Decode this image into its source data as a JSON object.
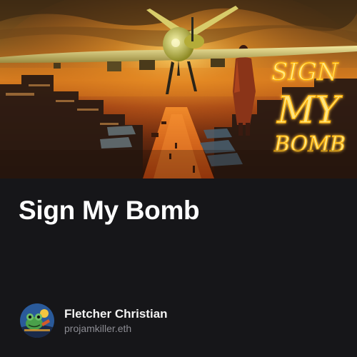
{
  "artwork": {
    "overlay_text": [
      "SIGN",
      "MY",
      "BOMB"
    ],
    "palette": {
      "sky_top": "#5a3a18",
      "sky_mid": "#c8781c",
      "glow": "#ffb23a",
      "street": "#e06a1a",
      "neon": "#ffd54a"
    }
  },
  "post": {
    "title": "Sign My Bomb"
  },
  "author": {
    "name": "Fletcher Christian",
    "handle": "projamkiller.eth",
    "avatar_icon": "frog-avatar-icon"
  },
  "colors": {
    "background": "#161619",
    "title": "#ffffff",
    "handle": "#8c8c93"
  }
}
